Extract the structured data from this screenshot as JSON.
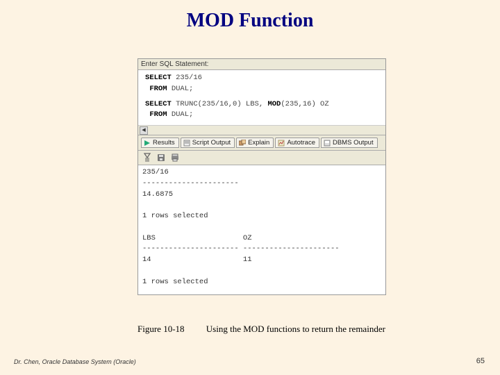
{
  "title": "MOD Function",
  "sql": {
    "enter_label": "Enter SQL Statement:",
    "line1_kw1": "SELECT",
    "line1_rest": " 235/16",
    "line2_kw1": "FROM",
    "line2_rest": " DUAL;",
    "line3_kw1": "SELECT",
    "line3_mid": " TRUNC(235/16,0) LBS, ",
    "line3_kw2": "MOD",
    "line3_rest": "(235,16) OZ",
    "line4_kw1": "FROM",
    "line4_rest": " DUAL;"
  },
  "tabs": {
    "results": "Results",
    "script": "Script Output",
    "explain": "Explain",
    "autotrace": "Autotrace",
    "dbms": "DBMS Output"
  },
  "output": "235/16\n----------------------\n14.6875\n\n1 rows selected\n\nLBS                    OZ\n---------------------- ----------------------\n14                     11\n\n1 rows selected",
  "caption": {
    "fig": "Figure 10-18",
    "desc": "Using the MOD functions to return the remainder"
  },
  "footer": {
    "left": "Dr. Chen, Oracle Database System (Oracle)",
    "page": "65"
  }
}
